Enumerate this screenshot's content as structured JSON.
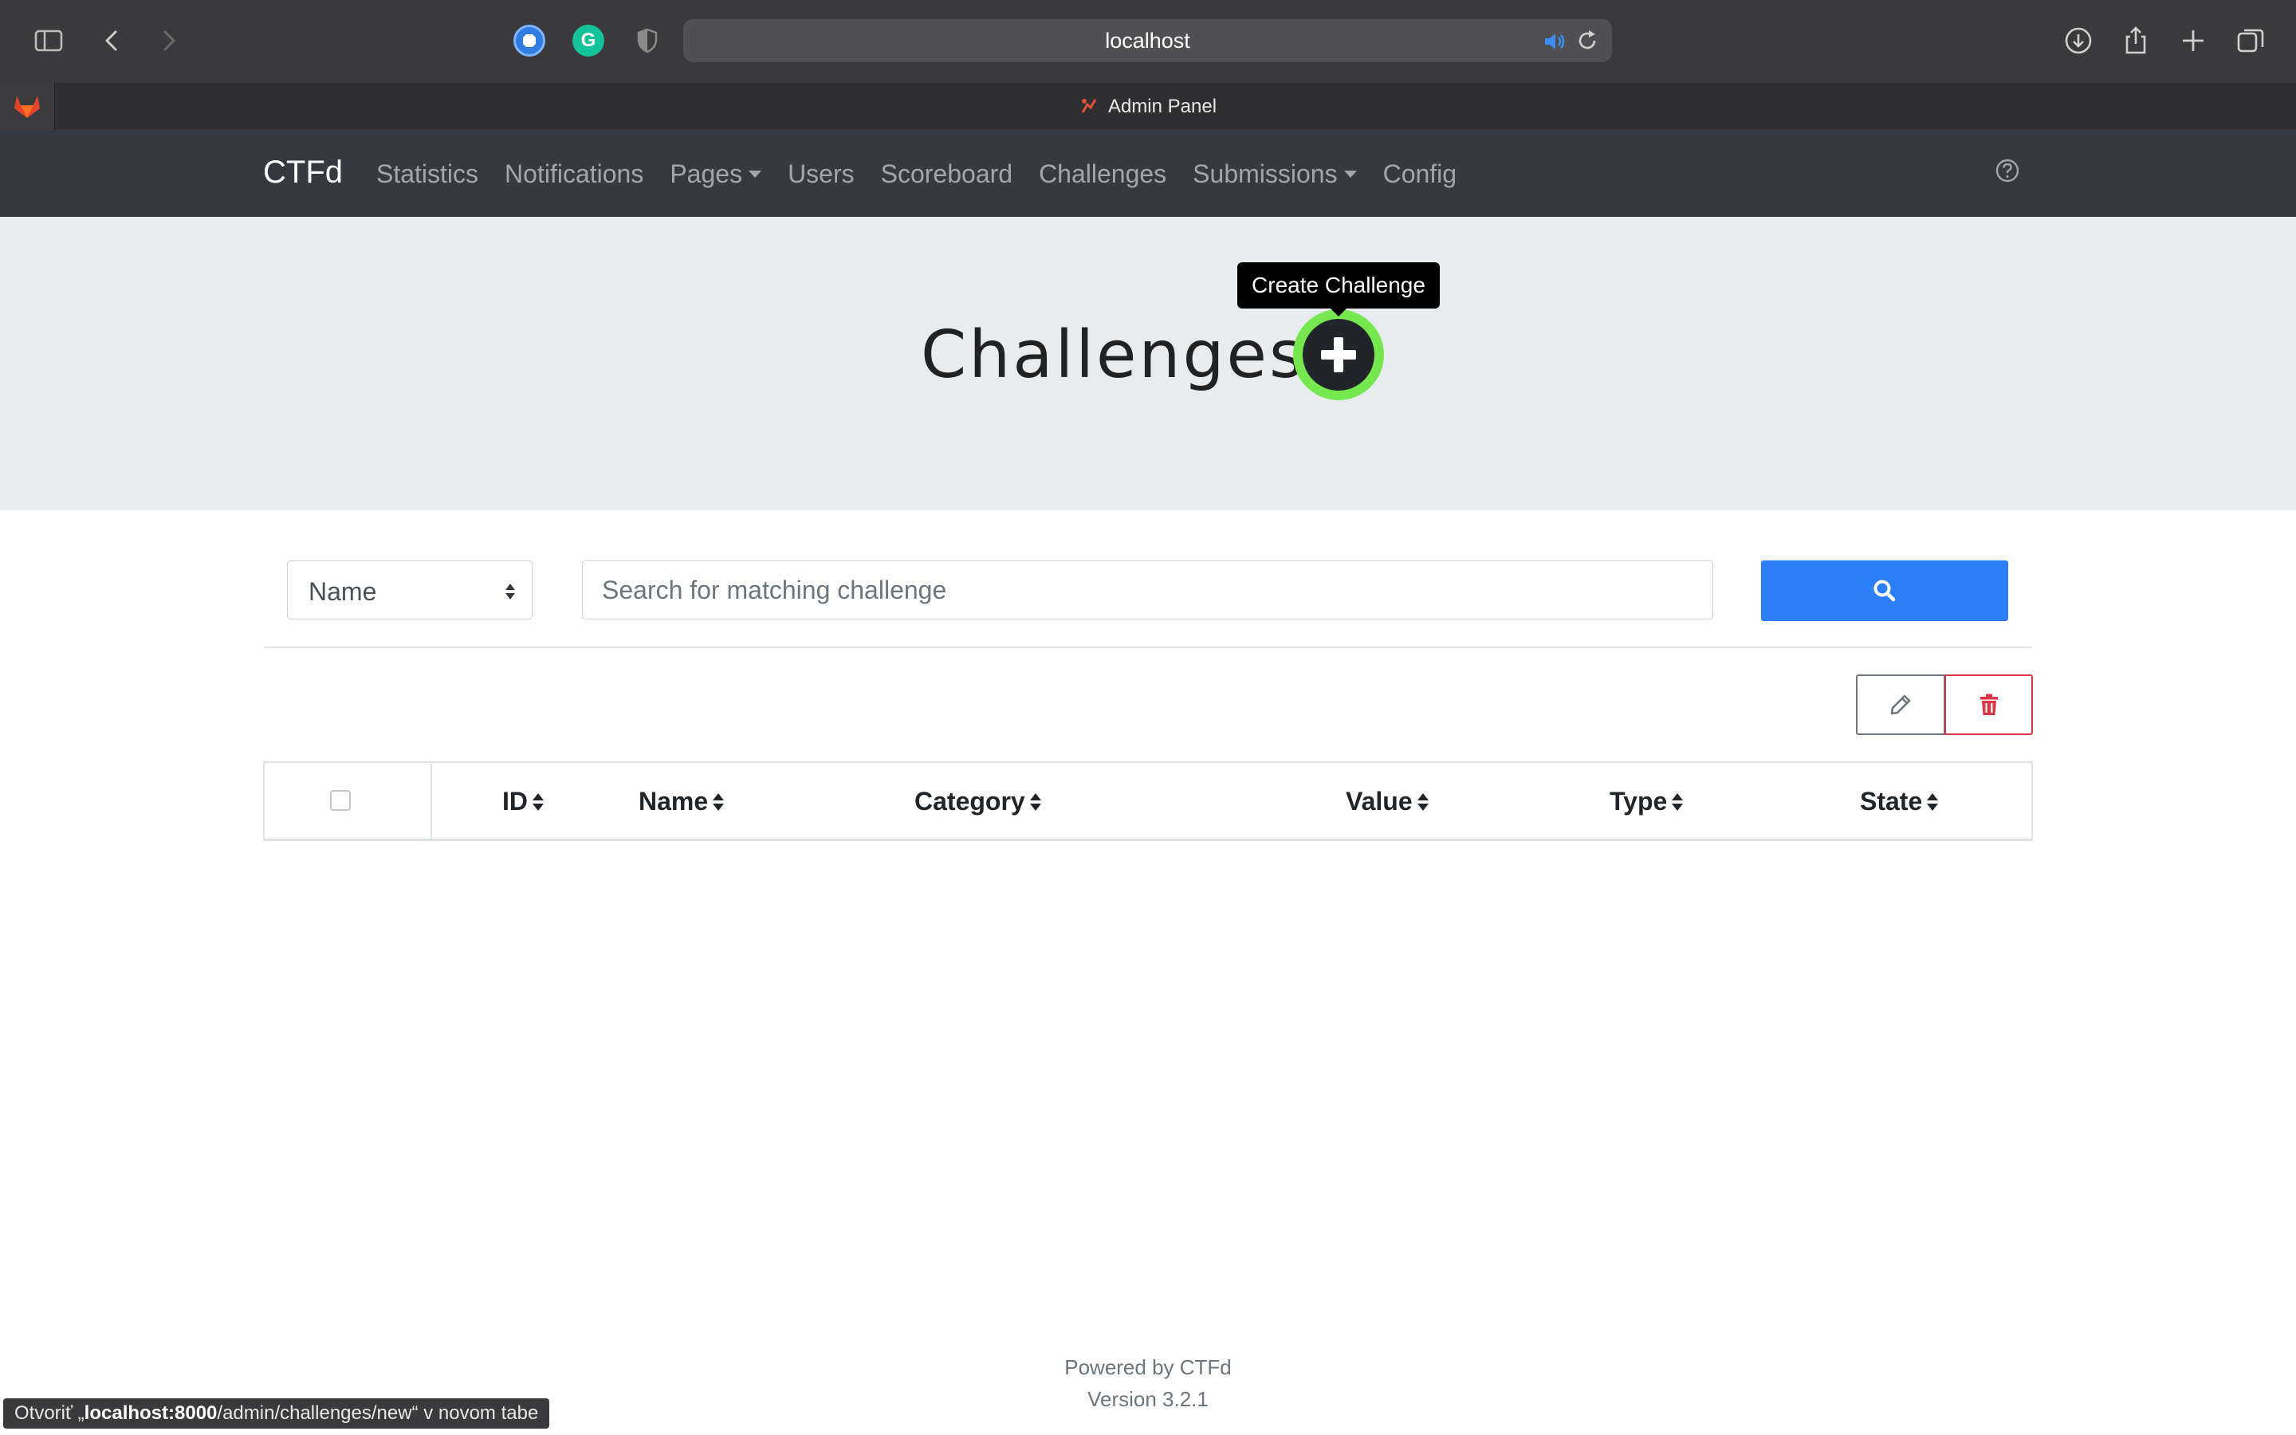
{
  "browser": {
    "url": "localhost",
    "tab_title": "Admin Panel",
    "status_prefix": "Otvoriť „",
    "status_host": "localhost:8000",
    "status_path": "/admin/challenges/new",
    "status_suffix": "“ v novom tabe"
  },
  "navbar": {
    "brand": "CTFd",
    "links": [
      {
        "label": "Statistics",
        "dropdown": false
      },
      {
        "label": "Notifications",
        "dropdown": false
      },
      {
        "label": "Pages",
        "dropdown": true
      },
      {
        "label": "Users",
        "dropdown": false
      },
      {
        "label": "Scoreboard",
        "dropdown": false
      },
      {
        "label": "Challenges",
        "dropdown": false
      },
      {
        "label": "Submissions",
        "dropdown": true
      },
      {
        "label": "Config",
        "dropdown": false
      }
    ]
  },
  "header": {
    "title": "Challenges",
    "create_tooltip": "Create Challenge"
  },
  "search": {
    "field_value": "Name",
    "placeholder": "Search for matching challenge",
    "query": ""
  },
  "table": {
    "columns": [
      "ID",
      "Name",
      "Category",
      "Value",
      "Type",
      "State"
    ],
    "rows": []
  },
  "footer": {
    "powered": "Powered by CTFd",
    "version": "Version 3.2.1"
  },
  "colors": {
    "primary": "#2d7ff9",
    "danger": "#dc3545",
    "navbar_bg": "#343a40",
    "highlight": "#76e84f"
  }
}
